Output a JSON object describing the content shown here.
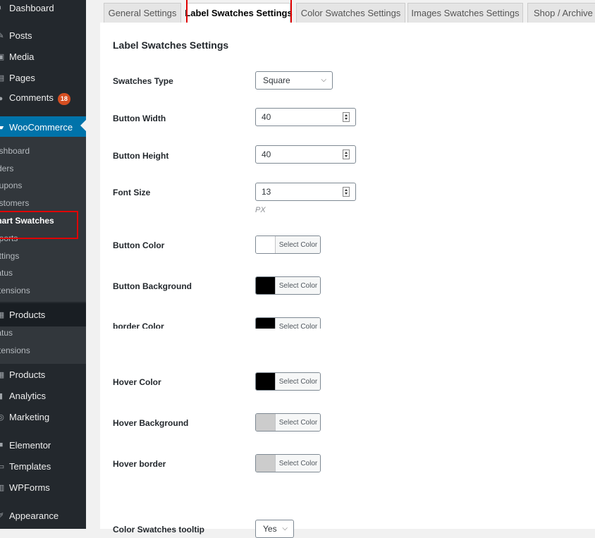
{
  "sidebar": {
    "items": [
      {
        "label": "Dashboard",
        "icon": "dashboard-icon"
      },
      {
        "label": "Posts",
        "icon": "pin-icon"
      },
      {
        "label": "Media",
        "icon": "media-icon"
      },
      {
        "label": "Pages",
        "icon": "page-icon"
      },
      {
        "label": "Comments",
        "icon": "comment-icon",
        "badge": "18"
      },
      {
        "label": "WooCommerce",
        "icon": "woocommerce-icon"
      }
    ],
    "woo_submenu": [
      "ashboard",
      "rders",
      "oupons",
      "ustomers",
      "mart Swatches",
      "eports",
      "ettings",
      "tatus",
      "xtensions"
    ],
    "products": {
      "label": "Products",
      "icon": "products-icon"
    },
    "products_submenu": [
      "tatus",
      "xtensions"
    ],
    "lower_items": [
      {
        "label": "Products",
        "icon": "products-icon"
      },
      {
        "label": "Analytics",
        "icon": "analytics-icon"
      },
      {
        "label": "Marketing",
        "icon": "marketing-icon"
      },
      {
        "label": "Elementor",
        "icon": "elementor-icon"
      },
      {
        "label": "Templates",
        "icon": "templates-icon"
      },
      {
        "label": "WPForms",
        "icon": "wpforms-icon"
      },
      {
        "label": "Appearance",
        "icon": "appearance-icon"
      }
    ]
  },
  "tabs": [
    {
      "label": "General Settings"
    },
    {
      "label": "Label Swatches Settings",
      "active": true
    },
    {
      "label": "Color Swatches Settings"
    },
    {
      "label": "Images Swatches Settings"
    },
    {
      "label": "Shop / Archive"
    }
  ],
  "panel": {
    "title": "Label Swatches Settings",
    "swatches_type": {
      "label": "Swatches Type",
      "value": "Square"
    },
    "button_width": {
      "label": "Button Width",
      "value": "40"
    },
    "button_height": {
      "label": "Button Height",
      "value": "40"
    },
    "font_size": {
      "label": "Font Size",
      "value": "13",
      "unit": "PX"
    },
    "select_color_label": "Select Color",
    "colors": [
      {
        "label": "Button Color",
        "swatch": "#ffffff"
      },
      {
        "label": "Button Background",
        "swatch": "#000000"
      },
      {
        "label": "border Color",
        "swatch": "#000000"
      },
      {
        "label": "Hover Color",
        "swatch": "#000000"
      },
      {
        "label": "Hover Background",
        "swatch": "#cccccc"
      },
      {
        "label": "Hover border",
        "swatch": "#cccccc"
      }
    ],
    "tooltip": {
      "label": "Color Swatches tooltip",
      "value": "Yes"
    }
  },
  "colors": {
    "sidebar_bg": "#23282d",
    "active_menu": "#0073aa",
    "highlight": "#e00000"
  }
}
